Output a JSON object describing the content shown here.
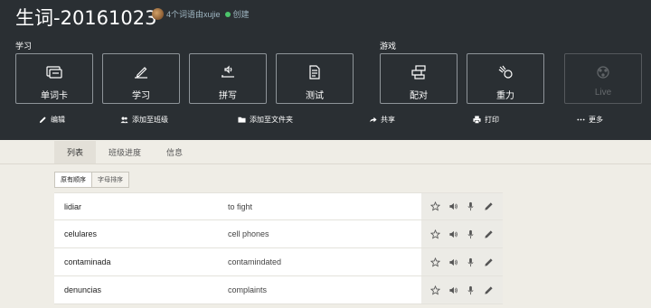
{
  "header": {
    "title": "生词-20161023",
    "author_text": "4个词语由xujie",
    "created_text": "创建"
  },
  "sections": {
    "study": "学习",
    "games": "游戏"
  },
  "modes": {
    "flashcards": "单词卡",
    "learn": "学习",
    "spell": "拼写",
    "test": "测试",
    "match": "配对",
    "gravity": "重力",
    "live": "Live"
  },
  "actions": {
    "edit": "编辑",
    "add_to_class": "添加至班级",
    "add_to_folder": "添加至文件夹",
    "share": "共享",
    "print": "打印",
    "more": "更多"
  },
  "tabs": [
    "列表",
    "班级进度",
    "信息"
  ],
  "sort": {
    "original": "原有顺序",
    "alphabetical": "字母排序"
  },
  "terms": [
    {
      "word": "lidiar",
      "definition": "to fight"
    },
    {
      "word": "celulares",
      "definition": "cell phones"
    },
    {
      "word": "contaminada",
      "definition": "contamindated"
    },
    {
      "word": "denuncias",
      "definition": "complaints"
    }
  ],
  "icons": {
    "star": "star-icon",
    "audio": "speaker-icon",
    "mic": "microphone-icon",
    "edit": "pencil-icon"
  },
  "colors": {
    "header_bg": "#2a2f33",
    "page_bg": "#efede6",
    "creator_dot": "#4cc46b"
  }
}
